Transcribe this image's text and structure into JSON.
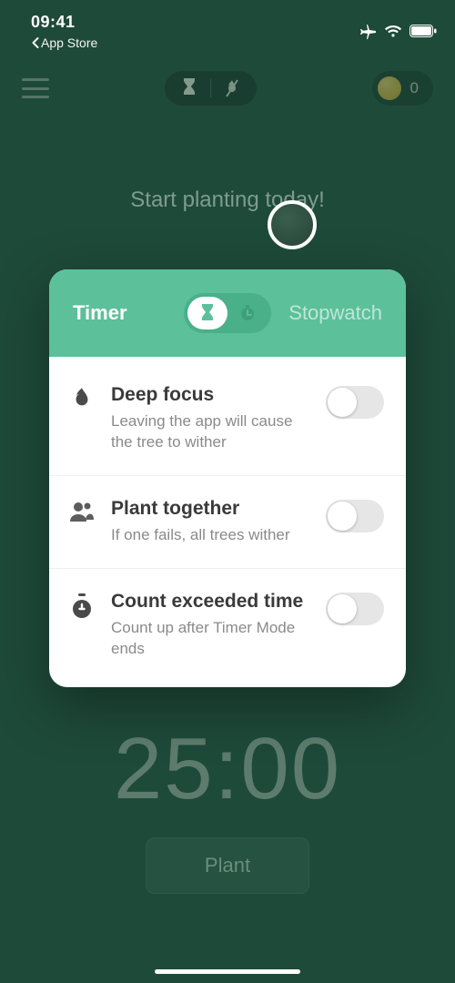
{
  "status": {
    "time": "09:41",
    "back_label": "App Store"
  },
  "appbar": {
    "coins": "0"
  },
  "main": {
    "headline": "Start planting today!",
    "timer": "25:00",
    "plant_button": "Plant"
  },
  "modal": {
    "timer_tab": "Timer",
    "stopwatch_tab": "Stopwatch",
    "settings": [
      {
        "title": "Deep focus",
        "desc": "Leaving the app will cause the tree to wither",
        "icon": "flame-icon",
        "enabled": false
      },
      {
        "title": "Plant together",
        "desc": "If one fails, all trees wither",
        "icon": "people-icon",
        "enabled": false
      },
      {
        "title": "Count exceeded time",
        "desc": "Count up after Timer Mode ends",
        "icon": "timer-plus-icon",
        "enabled": false
      }
    ]
  }
}
